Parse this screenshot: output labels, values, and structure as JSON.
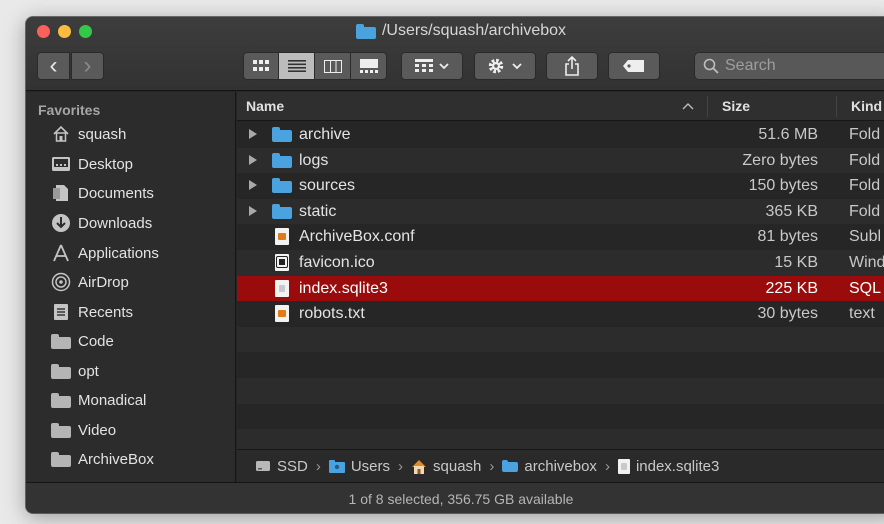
{
  "window": {
    "title": "/Users/squash/archivebox"
  },
  "toolbar": {
    "back_label": "‹",
    "forward_label": "›",
    "search_placeholder": "Search"
  },
  "sidebar": {
    "heading": "Favorites",
    "items": [
      {
        "label": "squash",
        "icon": "home-icon"
      },
      {
        "label": "Desktop",
        "icon": "desktop-icon"
      },
      {
        "label": "Documents",
        "icon": "documents-icon"
      },
      {
        "label": "Downloads",
        "icon": "downloads-icon"
      },
      {
        "label": "Applications",
        "icon": "applications-icon"
      },
      {
        "label": "AirDrop",
        "icon": "airdrop-icon"
      },
      {
        "label": "Recents",
        "icon": "recents-icon"
      },
      {
        "label": "Code",
        "icon": "folder-icon"
      },
      {
        "label": "opt",
        "icon": "folder-icon"
      },
      {
        "label": "Monadical",
        "icon": "folder-icon"
      },
      {
        "label": "Video",
        "icon": "folder-icon"
      },
      {
        "label": "ArchiveBox",
        "icon": "folder-icon"
      }
    ]
  },
  "columns": {
    "name": "Name",
    "size": "Size",
    "kind": "Kind"
  },
  "files": [
    {
      "name": "archive",
      "size": "51.6 MB",
      "kind": "Fold"
    },
    {
      "name": "logs",
      "size": "Zero bytes",
      "kind": "Fold"
    },
    {
      "name": "sources",
      "size": "150 bytes",
      "kind": "Fold"
    },
    {
      "name": "static",
      "size": "365 KB",
      "kind": "Fold"
    },
    {
      "name": "ArchiveBox.conf",
      "size": "81 bytes",
      "kind": "Subl"
    },
    {
      "name": "favicon.ico",
      "size": "15 KB",
      "kind": "Wind"
    },
    {
      "name": "index.sqlite3",
      "size": "225 KB",
      "kind": "SQL"
    },
    {
      "name": "robots.txt",
      "size": "30 bytes",
      "kind": "text"
    }
  ],
  "pathbar": [
    "SSD",
    "Users",
    "squash",
    "archivebox",
    "index.sqlite3"
  ],
  "status": "1 of 8 selected, 356.75 GB available",
  "colors": {
    "selection": "#9a0c0c",
    "folder": "#4aa3df"
  }
}
